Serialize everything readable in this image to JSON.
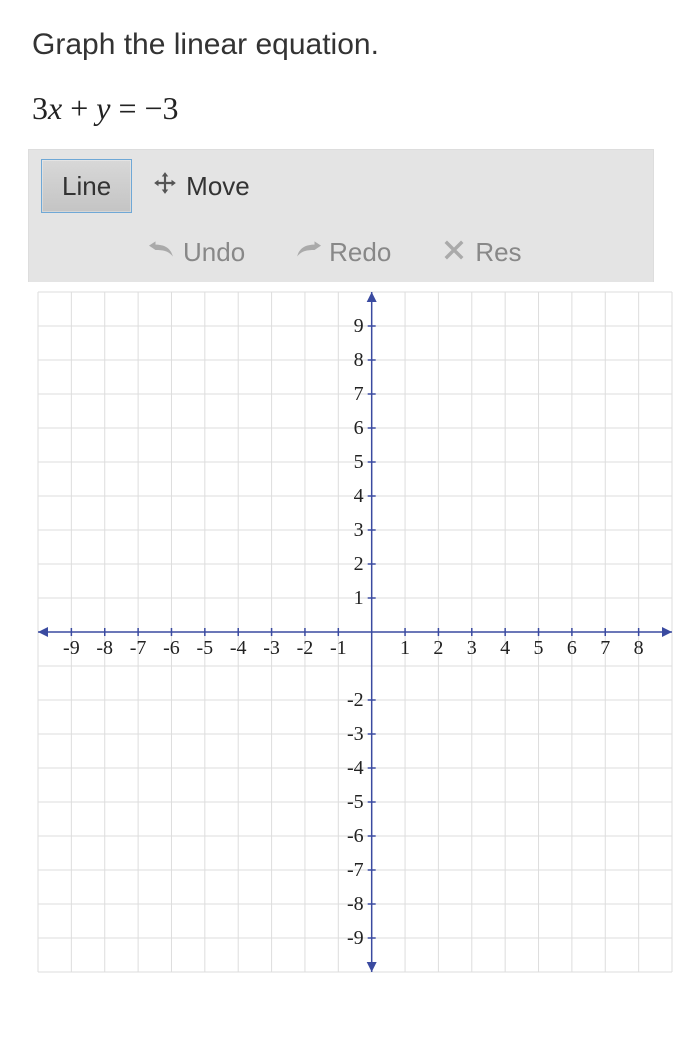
{
  "prompt": "Graph the linear equation.",
  "equation": {
    "lhs_a": "3",
    "lhs_xvar": "x",
    "lhs_plus": " + ",
    "lhs_yvar": "y",
    "eq": " = ",
    "rhs": "−3"
  },
  "toolbar": {
    "line_label": "Line",
    "move_label": "Move",
    "undo_label": "Undo",
    "redo_label": "Redo",
    "reset_label": "Res"
  },
  "chart_data": {
    "type": "line",
    "title": "",
    "xlabel": "",
    "ylabel": "",
    "xlim": [
      -10,
      9
    ],
    "ylim": [
      -10,
      10
    ],
    "x_ticks": [
      -9,
      -8,
      -7,
      -6,
      -5,
      -4,
      -3,
      -2,
      -1,
      1,
      2,
      3,
      4,
      5,
      6,
      7,
      8
    ],
    "y_ticks": [
      -9,
      -8,
      -7,
      -6,
      -5,
      -4,
      -3,
      -2,
      1,
      2,
      3,
      4,
      5,
      6,
      7,
      8,
      9
    ],
    "grid": true,
    "series": []
  }
}
